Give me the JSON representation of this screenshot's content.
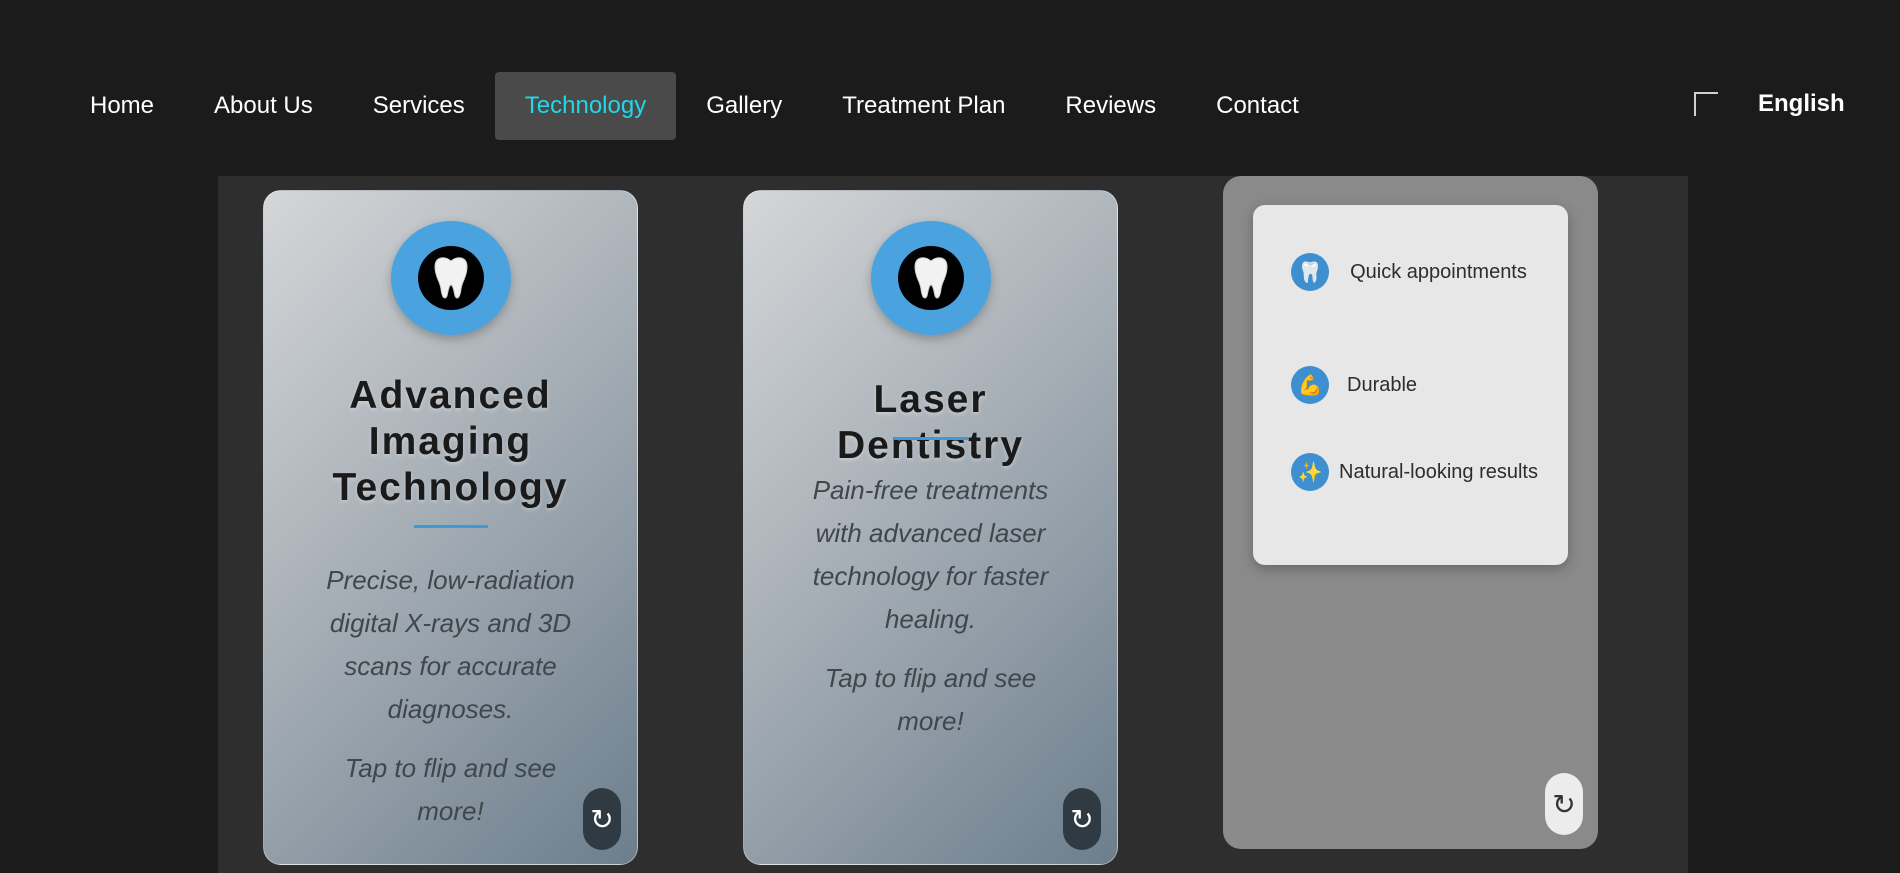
{
  "nav": {
    "items": [
      {
        "label": "Home",
        "active": false
      },
      {
        "label": "About Us",
        "active": false
      },
      {
        "label": "Services",
        "active": false
      },
      {
        "label": "Technology",
        "active": true
      },
      {
        "label": "Gallery",
        "active": false
      },
      {
        "label": "Treatment Plan",
        "active": false
      },
      {
        "label": "Reviews",
        "active": false
      },
      {
        "label": "Contact",
        "active": false
      }
    ],
    "language": "English"
  },
  "cards": [
    {
      "title": "Advanced Imaging Technology",
      "description": "Precise, low-radiation digital X-rays and 3D scans for accurate diagnoses.",
      "tap_hint": "Tap to flip and see more!",
      "icon": "tooth-icon",
      "flip_icon": "↻"
    },
    {
      "title": "Laser Dentistry",
      "description": "Pain-free treatments with advanced laser technology for faster healing.",
      "tap_hint": "Tap to flip and see more!",
      "icon": "tooth-icon",
      "flip_icon": "↻"
    }
  ],
  "back_card": {
    "features": [
      {
        "icon": "🦷",
        "icon_name": "tooth-icon",
        "label": "Quick appointments"
      },
      {
        "icon": "💪",
        "icon_name": "flexed-biceps-icon",
        "label": "Durable"
      },
      {
        "icon": "✨",
        "icon_name": "sparkles-icon",
        "label": "Natural-looking results"
      }
    ],
    "flip_icon": "↻"
  },
  "colors": {
    "background": "#1b1b1b",
    "active_nav_text": "#22d7e6",
    "accent_blue": "#4aa3df"
  }
}
